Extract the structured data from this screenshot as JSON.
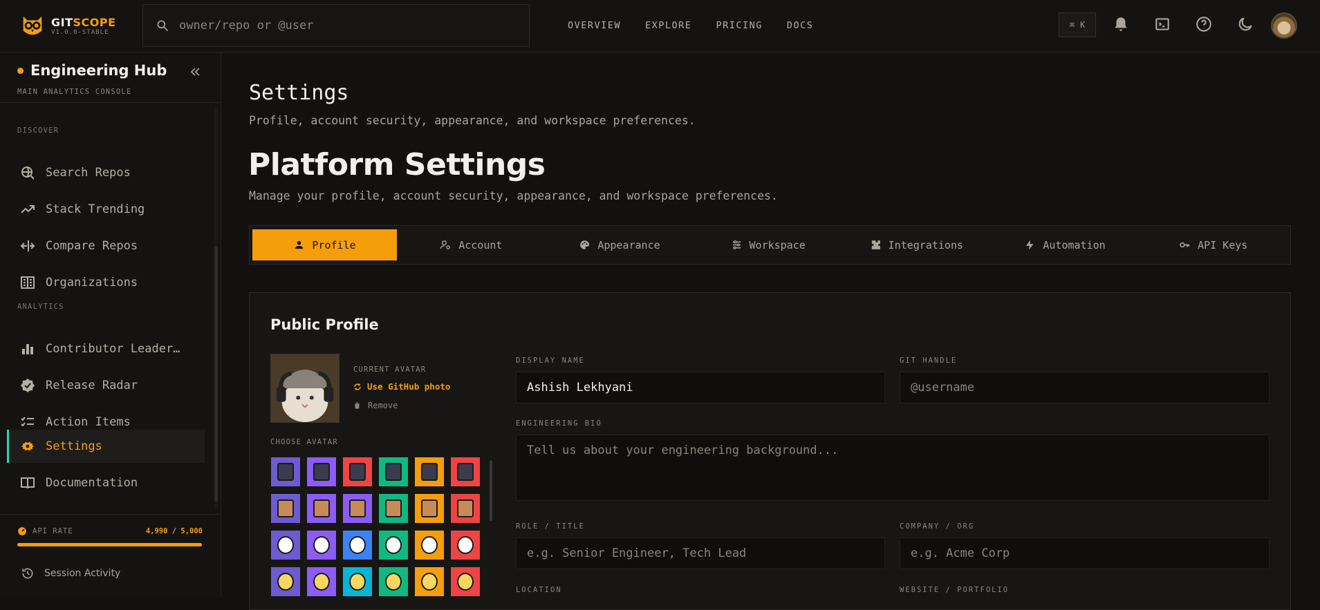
{
  "app": {
    "brand_a": "GIT",
    "brand_b": "SCOPE",
    "version": "V1.0.0-STABLE"
  },
  "search": {
    "placeholder": "owner/repo or @user"
  },
  "topnav": [
    "OVERVIEW",
    "EXPLORE",
    "PRICING",
    "DOCS"
  ],
  "shortcut": {
    "symbol": "⌘",
    "key": "K"
  },
  "sidebar": {
    "hub_title": "Engineering Hub",
    "hub_subtitle": "MAIN ANALYTICS CONSOLE",
    "sections": [
      "DISCOVER",
      "ANALYTICS"
    ],
    "items": [
      {
        "label": "Search Repos",
        "icon": "search-globe-icon"
      },
      {
        "label": "Stack Trending",
        "icon": "trending-up-icon"
      },
      {
        "label": "Compare Repos",
        "icon": "compare-icon"
      },
      {
        "label": "Organizations",
        "icon": "building-icon"
      },
      {
        "label": "Contributor Leader…",
        "icon": "bar-chart-icon"
      },
      {
        "label": "Release Radar",
        "icon": "verified-badge-icon"
      },
      {
        "label": "Action Items",
        "icon": "checklist-icon"
      },
      {
        "label": "Settings",
        "icon": "gear-icon"
      },
      {
        "label": "Documentation",
        "icon": "book-icon"
      }
    ],
    "active_index": 7,
    "api_label": "API RATE",
    "api_value": "4,990 / 5,000",
    "api_fraction": 0.998,
    "session_label": "Session Activity"
  },
  "page": {
    "title": "Settings",
    "subtitle": "Profile, account security, appearance, and workspace preferences.",
    "heading": "Platform Settings",
    "description": "Manage your profile, account security, appearance, and workspace preferences."
  },
  "tabs": [
    {
      "label": "Profile",
      "icon": "person-icon"
    },
    {
      "label": "Account",
      "icon": "user-gear-icon"
    },
    {
      "label": "Appearance",
      "icon": "palette-icon"
    },
    {
      "label": "Workspace",
      "icon": "sliders-icon"
    },
    {
      "label": "Integrations",
      "icon": "puzzle-icon"
    },
    {
      "label": "Automation",
      "icon": "bolt-icon"
    },
    {
      "label": "API Keys",
      "icon": "key-icon"
    }
  ],
  "profile": {
    "section_title": "Public Profile",
    "current_avatar_label": "CURRENT AVATAR",
    "use_github": "Use GitHub photo",
    "remove": "Remove",
    "choose_avatar": "CHOOSE AVATAR",
    "avatar_colors": [
      "#6d5bd0",
      "#8b5cf6",
      "#ef4444",
      "#10b981",
      "#f59e0b",
      "#ef4444",
      "#6d5bd0",
      "#8b5cf6",
      "#8b5cf6",
      "#10b981",
      "#f59e0b",
      "#ef4444",
      "#6d5bd0",
      "#8b5cf6",
      "#3b82f6",
      "#10b981",
      "#f59e0b",
      "#ef4444",
      "#6d5bd0",
      "#8b5cf6",
      "#06b6d4",
      "#10b981",
      "#f59e0b",
      "#ef4444"
    ],
    "fields": {
      "display_name": {
        "label": "DISPLAY NAME",
        "value": "Ashish Lekhyani"
      },
      "git_handle": {
        "label": "GIT HANDLE",
        "placeholder": "@username"
      },
      "bio": {
        "label": "ENGINEERING BIO",
        "placeholder": "Tell us about your engineering background..."
      },
      "role": {
        "label": "ROLE / TITLE",
        "placeholder": "e.g. Senior Engineer, Tech Lead"
      },
      "company": {
        "label": "COMPANY / ORG",
        "placeholder": "e.g. Acme Corp"
      },
      "location": {
        "label": "LOCATION"
      },
      "website": {
        "label": "WEBSITE / PORTFOLIO"
      }
    }
  }
}
